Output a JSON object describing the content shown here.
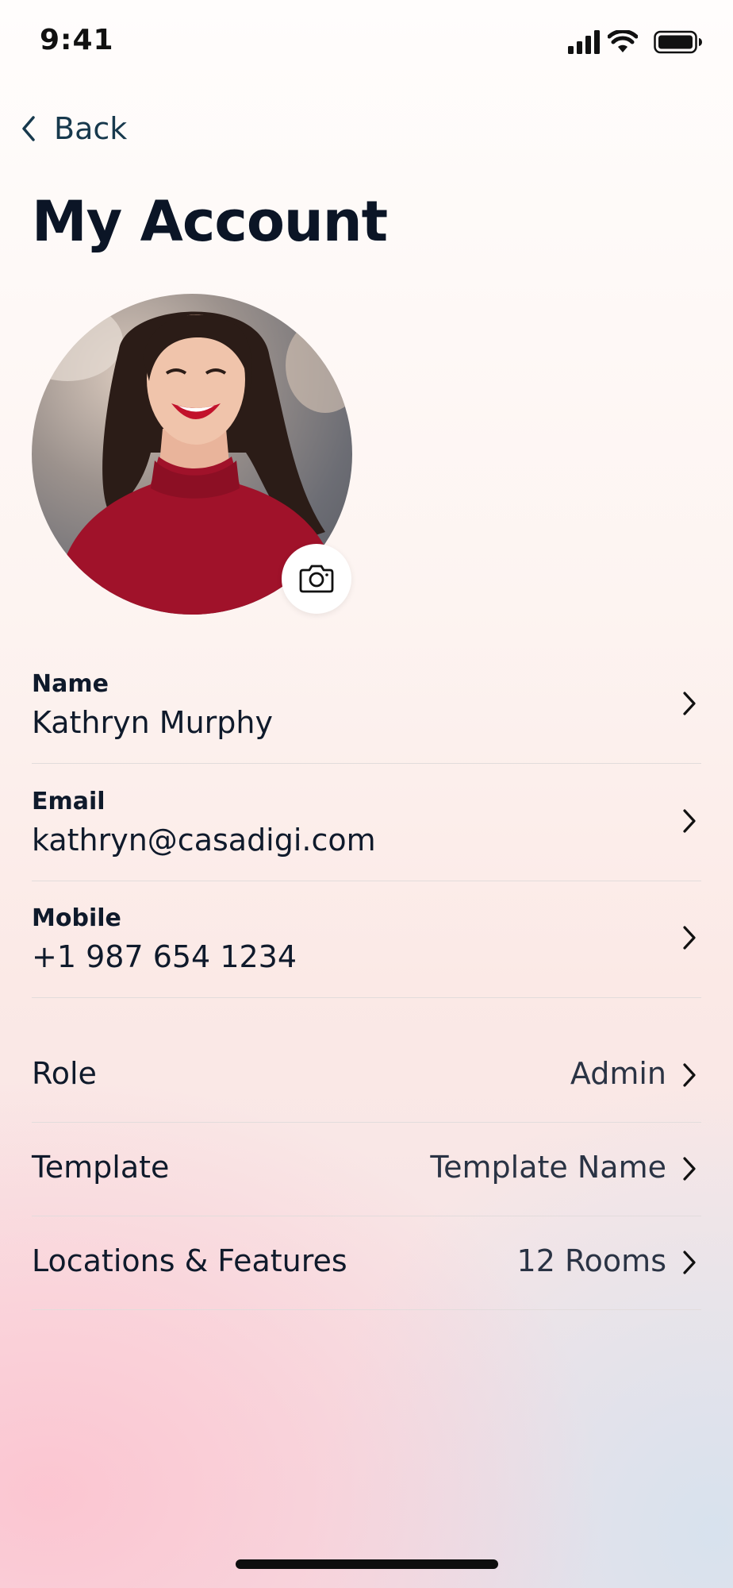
{
  "status_bar": {
    "time": "9:41"
  },
  "nav": {
    "back_label": "Back"
  },
  "page": {
    "title": "My Account"
  },
  "profile": {
    "fields": [
      {
        "label": "Name",
        "value": "Kathryn Murphy"
      },
      {
        "label": "Email",
        "value": "kathryn@casadigi.com"
      },
      {
        "label": "Mobile",
        "value": "+1 987 654 1234"
      }
    ],
    "settings": [
      {
        "label": "Role",
        "value": "Admin"
      },
      {
        "label": "Template",
        "value": "Template Name"
      },
      {
        "label": "Locations & Features",
        "value": "12 Rooms"
      }
    ]
  },
  "colors": {
    "text_primary": "#0f1a2b",
    "back_link": "#17394d",
    "divider": "#e2dcdc"
  },
  "icons": [
    "signal-icon",
    "wifi-icon",
    "battery-icon",
    "chevron-left-icon",
    "camera-icon",
    "chevron-right-icon"
  ]
}
